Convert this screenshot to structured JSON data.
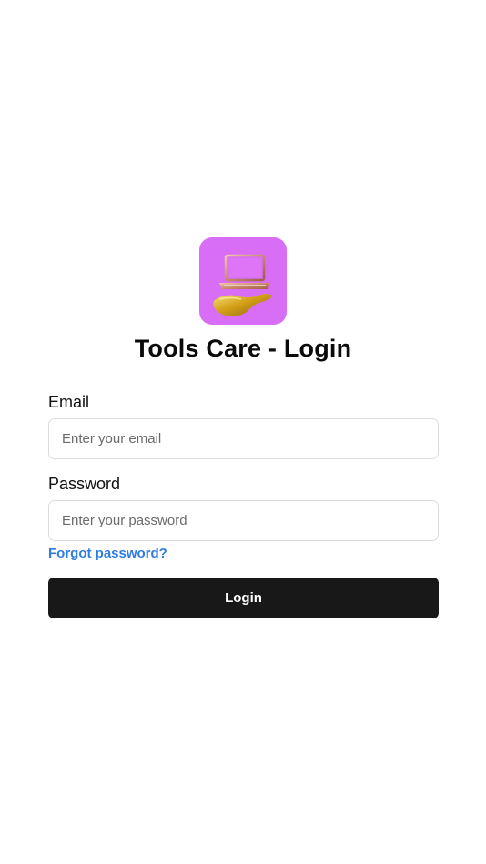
{
  "app": {
    "title": "Tools Care - Login",
    "logo_icon": "laptop-on-hand-icon",
    "logo_background": "#d86ef5"
  },
  "form": {
    "email_label": "Email",
    "email_placeholder": "Enter your email",
    "email_value": "",
    "password_label": "Password",
    "password_placeholder": "Enter your password",
    "password_value": "",
    "forgot_link": "Forgot password?",
    "submit_label": "Login"
  },
  "colors": {
    "link": "#2f7de1",
    "button_background": "#181818",
    "button_text": "#ffffff",
    "input_border": "#dcdcdc"
  }
}
